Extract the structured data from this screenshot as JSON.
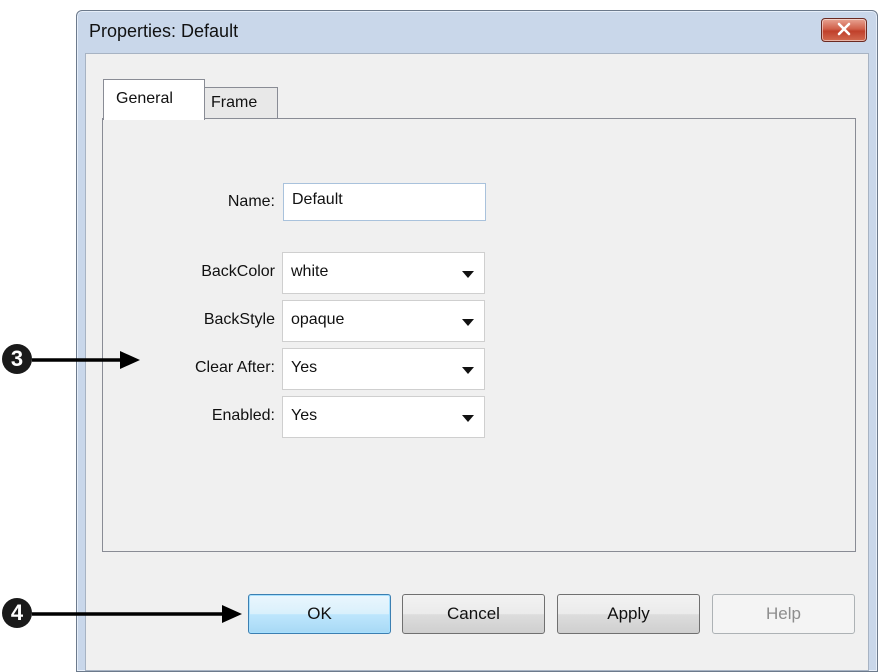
{
  "window": {
    "title": "Properties: Default"
  },
  "tabs": [
    {
      "label": "General",
      "selected": true
    },
    {
      "label": "Frame",
      "selected": false
    }
  ],
  "fields": {
    "name": {
      "label": "Name:",
      "value": "Default"
    },
    "backcolor": {
      "label": "BackColor",
      "value": "white"
    },
    "backstyle": {
      "label": "BackStyle",
      "value": "opaque"
    },
    "clear_after": {
      "label": "Clear After:",
      "value": "Yes"
    },
    "enabled": {
      "label": "Enabled:",
      "value": "Yes"
    }
  },
  "buttons": {
    "ok": "OK",
    "cancel": "Cancel",
    "apply": "Apply",
    "help": "Help"
  },
  "callouts": {
    "three": "3",
    "four": "4"
  },
  "colors": {
    "frame": "#c9d7ea",
    "client": "#f0f0f0",
    "ok_highlight": "#bee6fd",
    "close_button": "#c0402b"
  }
}
